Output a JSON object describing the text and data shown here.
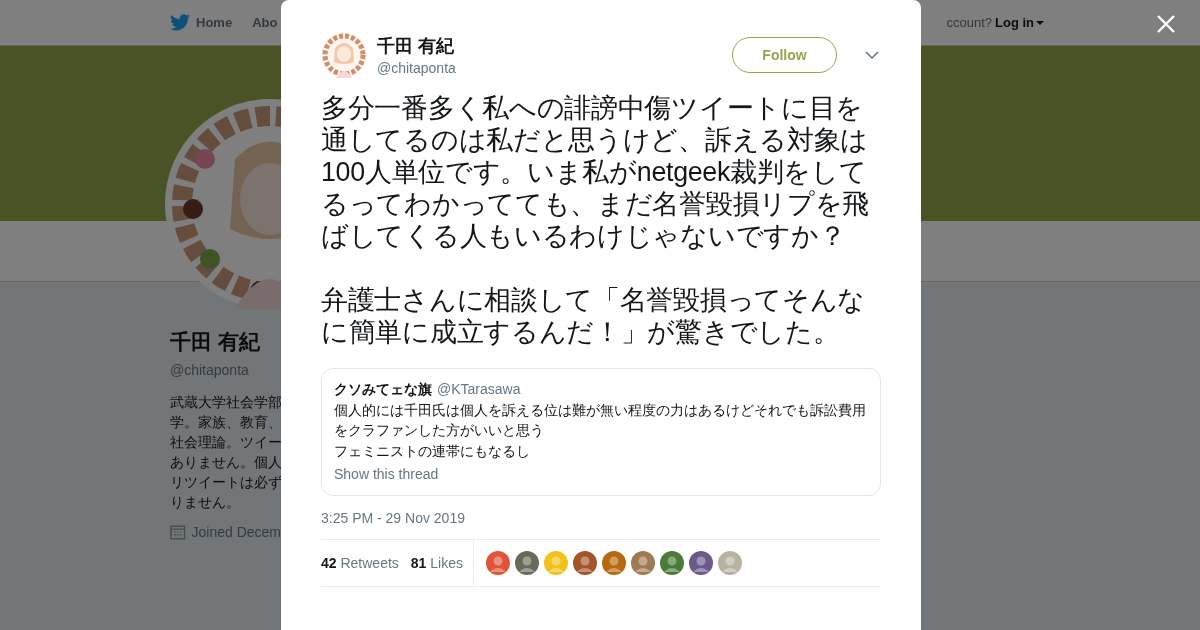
{
  "nav": {
    "home": "Home",
    "about": "Abo",
    "account_prompt": "ccount?",
    "login": "Log in"
  },
  "profile": {
    "name": "千田 有紀",
    "handle": "@chitaponta",
    "bio_lines": [
      "武蔵大学社会学部",
      "学。家族、教育、",
      "社会理論。ツイー",
      "ありません。個人",
      "リツイートは必ず",
      "りません。"
    ],
    "joined": "Joined Decem"
  },
  "tweet": {
    "author": "千田 有紀",
    "handle": "@chitaponta",
    "follow": "Follow",
    "paragraphs": [
      "多分一番多く私への誹謗中傷ツイートに目を通してるのは私だと思うけど、訴える対象は100人単位です。いま私がnetgeek裁判をしてるってわかってても、まだ名誉毀損リプを飛ばしてくる人もいるわけじゃないですか？",
      "弁護士さんに相談して「名誉毀損ってそんなに簡単に成立するんだ！」が驚きでした。"
    ],
    "quote": {
      "author": "クソみてェな旗",
      "handle": "@KTarasawa",
      "lines": [
        "個人的には千田氏は個人を訴える位は難が無い程度の力はあるけどそれでも訴訟費用をクラファンした方がいいと思う",
        "フェミニストの連帯にもなるし"
      ],
      "link": "Show this thread"
    },
    "time": "3:25 PM - 29 Nov 2019",
    "retweets": "42",
    "retweets_label": "Retweets",
    "likes": "81",
    "likes_label": "Likes",
    "likers": [
      {
        "color": "#e0553a"
      },
      {
        "color": "#6a6a5a"
      },
      {
        "color": "#f2c21b"
      },
      {
        "color": "#a2552a"
      },
      {
        "color": "#b56a10"
      },
      {
        "color": "#a07a52"
      },
      {
        "color": "#4d7a3a"
      },
      {
        "color": "#6a5a8a"
      },
      {
        "color": "#b9b2a2"
      }
    ]
  }
}
